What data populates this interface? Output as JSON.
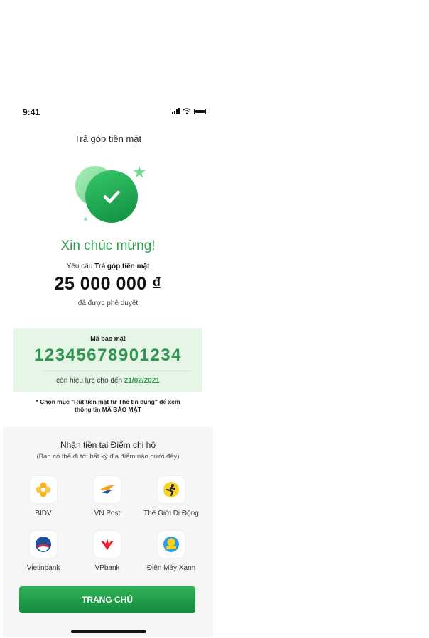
{
  "status_bar": {
    "time": "9:41"
  },
  "header": {
    "title": "Trả góp tiền mặt"
  },
  "success": {
    "title": "Xin chúc mừng!",
    "request_prefix": "Yêu cầu",
    "request_product": "Trả góp tiền mặt",
    "amount": "25 000 000 ₫",
    "approved_text": "đã được phê duyệt"
  },
  "security": {
    "label": "Mã bảo mật",
    "code": "12345678901234",
    "valid_prefix": "còn hiệu lực cho đến",
    "valid_date": "21/02/2021",
    "note_line1": "* Chọn mục \"Rút tiền mặt từ Thẻ tín dụng\" để xem",
    "note_line2": "thông tin MÃ BẢO MẬT"
  },
  "pickup": {
    "title": "Nhận tiền tại Điểm chi hộ",
    "subtitle": "(Bạn có thể đi tới bất kỳ địa điểm nào dưới đây)",
    "partners": [
      {
        "name": "BIDV",
        "icon": "bidv-logo-icon",
        "color": "#f5b21b"
      },
      {
        "name": "VN Post",
        "icon": "vnpost-logo-icon",
        "color": "#f6a21d"
      },
      {
        "name": "Thế Giới Di Động",
        "icon": "thegioididong-logo-icon",
        "color": "#f7d21e"
      },
      {
        "name": "Vietinbank",
        "icon": "vietinbank-logo-icon",
        "color": "#1b4e9b"
      },
      {
        "name": "VPbank",
        "icon": "vpbank-logo-icon",
        "color": "#e8232b"
      },
      {
        "name": "Điện Máy Xanh",
        "icon": "dienmayxanh-logo-icon",
        "color": "#2a9df4"
      }
    ]
  },
  "cta": {
    "label": "TRANG CHỦ"
  },
  "colors": {
    "brand_green": "#2f9e4f",
    "code_bg": "#e5f6e6",
    "panel_bg": "#f6f6f6"
  }
}
